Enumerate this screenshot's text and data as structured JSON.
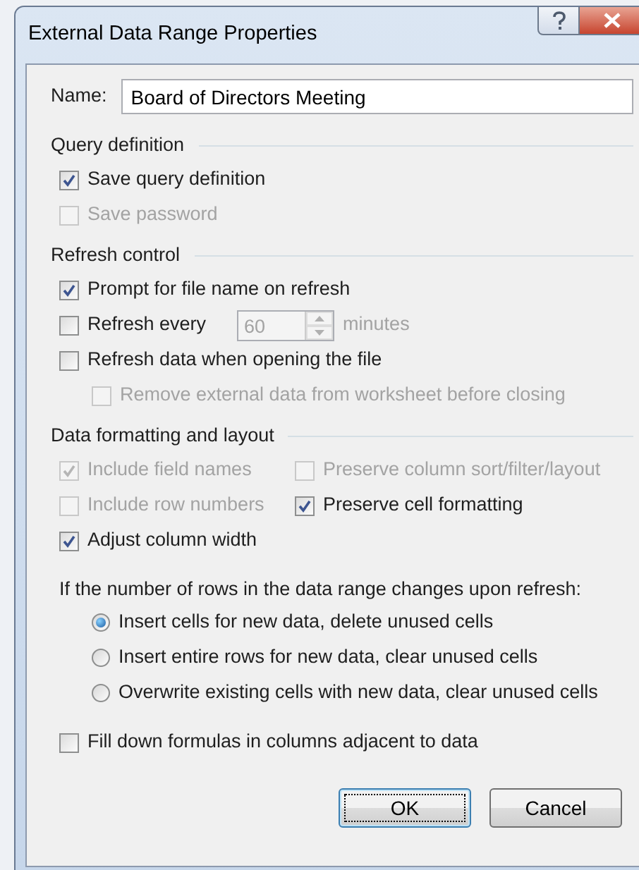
{
  "window": {
    "title": "External Data Range Properties"
  },
  "name_field": {
    "label": "Name:",
    "value": "Board of Directors Meeting"
  },
  "sections": [
    {
      "title": "Query definition",
      "items": [
        {
          "kind": "checkbox",
          "label": "Save query definition",
          "checked": true,
          "disabled": false
        },
        {
          "kind": "checkbox",
          "label": "Save password",
          "checked": false,
          "disabled": true
        }
      ]
    },
    {
      "title": "Refresh control",
      "items": [
        {
          "kind": "checkbox",
          "label": "Prompt for file name on refresh",
          "checked": true,
          "disabled": false
        },
        {
          "kind": "spin",
          "label": "Refresh every",
          "checked": false,
          "disabled": false,
          "value": "60",
          "unit": "minutes",
          "spin_disabled": true
        },
        {
          "kind": "checkbox",
          "label": "Refresh data when opening the file",
          "checked": false,
          "disabled": false,
          "children": [
            {
              "label": "Remove external data from worksheet before closing",
              "checked": false,
              "disabled": true
            }
          ]
        }
      ]
    },
    {
      "title": "Data formatting and layout",
      "items": [
        {
          "kind": "pair",
          "cells": [
            {
              "label": "Include field names",
              "checked": true,
              "disabled": true
            },
            {
              "label": "Preserve column sort/filter/layout",
              "checked": false,
              "disabled": true
            }
          ]
        },
        {
          "kind": "pair",
          "cells": [
            {
              "label": "Include row numbers",
              "checked": false,
              "disabled": true
            },
            {
              "label": "Preserve cell formatting",
              "checked": true,
              "disabled": false
            }
          ]
        },
        {
          "kind": "checkbox",
          "label": "Adjust column width",
          "checked": true,
          "disabled": false
        },
        {
          "kind": "note",
          "label": "If the number of rows in the data range changes upon refresh:"
        },
        {
          "kind": "radio",
          "label": "Insert cells for new data, delete unused cells",
          "selected": true
        },
        {
          "kind": "radio",
          "label": "Insert entire rows for new data, clear unused cells",
          "selected": false
        },
        {
          "kind": "radio",
          "label": "Overwrite existing cells with new data, clear unused cells",
          "selected": false
        },
        {
          "kind": "checkbox",
          "label": "Fill down formulas in columns adjacent to data",
          "checked": false,
          "disabled": false
        }
      ]
    }
  ],
  "buttons": [
    {
      "label": "OK",
      "default": true
    },
    {
      "label": "Cancel",
      "default": false
    }
  ]
}
